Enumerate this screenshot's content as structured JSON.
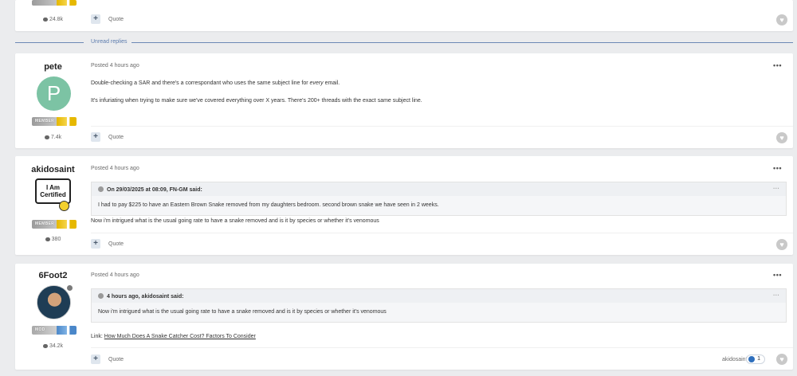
{
  "top_card": {
    "post_count": "24.8k",
    "quote_label": "Quote"
  },
  "divider": {
    "label": "Unread replies"
  },
  "posts": [
    {
      "author": "pete",
      "avatar_letter": "P",
      "rank": "MEMBER",
      "post_count": "7.4k",
      "posted": "Posted 4 hours ago",
      "line1_pre": "Double-checking a SAR and there's a correspondant who uses the same subject line for ",
      "line1_em": "every",
      "line1_post": " email.",
      "line2": "It's infuriating when trying to make sure we've covered everything over X years.  There's 200+ threads with the exact same subject line.",
      "quote_label": "Quote"
    },
    {
      "author": "akidosaint",
      "avatar_text": "I Am Certified",
      "rank": "MEMBER",
      "post_count": "380",
      "posted": "Posted 4 hours ago",
      "quote_head": "On 29/03/2025 at 08:09, FN-GM said:",
      "quote_body": "I had to pay $225 to have an Eastern Brown Snake removed from my daughters bedroom. second brown snake we have seen in 2 weeks.",
      "text": "Now i'm intrigued what is the usual going rate to have a snake removed and is it by species or whether it's venomous",
      "quote_label": "Quote"
    },
    {
      "author": "6Foot2",
      "rank": "MOD",
      "post_count": "34.2k",
      "posted": "Posted 4 hours ago",
      "quote_head": "4 hours ago, akidosaint said:",
      "quote_body": "Now i'm intrigued what is the usual going rate to have a snake removed and is it by species or whether it's venomous",
      "link_prefix": "Link: ",
      "link_text": "How Much Does A Snake Catcher Cost? Factors To Consider",
      "liked_by": "akidosaint",
      "like_count": "1",
      "quote_label": "Quote"
    }
  ],
  "icons": {
    "menu": "more-dots-icon",
    "reaction": "heart-icon",
    "count": "comment-bubble-icon"
  }
}
